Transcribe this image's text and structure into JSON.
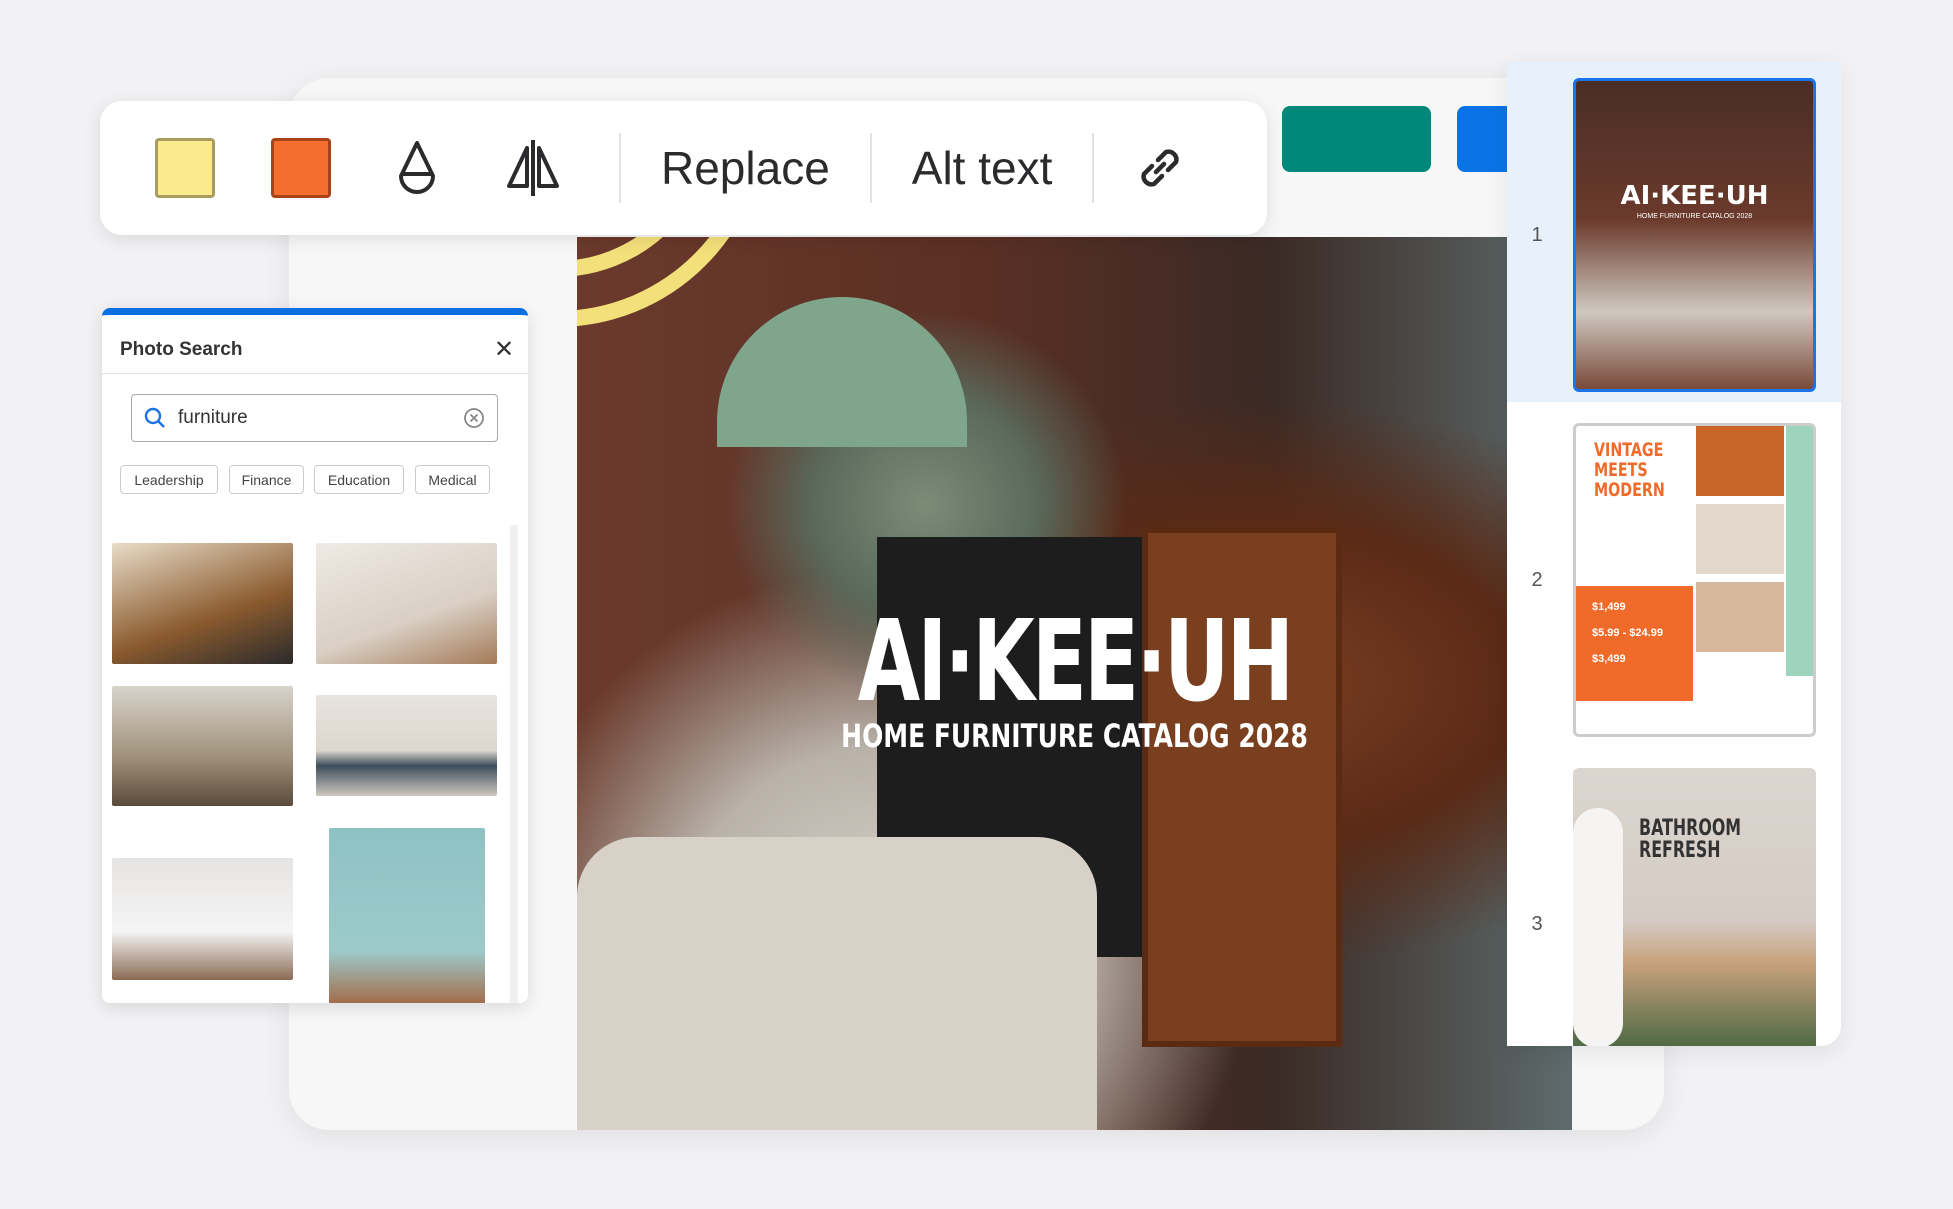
{
  "toolbar": {
    "swatches": [
      {
        "name": "yellow",
        "color": "#fde98e"
      },
      {
        "name": "orange",
        "color": "#f36f30"
      }
    ],
    "replace_label": "Replace",
    "alt_text_label": "Alt text",
    "accent_teal": "#00897a",
    "accent_blue": "#0a74e6"
  },
  "canvas": {
    "title": "AI·KEE·UH",
    "subtitle": "HOME FURNITURE CATALOG 2028"
  },
  "pages": [
    {
      "number": "1",
      "selected": true,
      "title": "AI·KEE·UH",
      "subtitle": "HOME FURNITURE CATALOG 2028"
    },
    {
      "number": "2",
      "title": "VINTAGE MEETS MODERN",
      "prices": [
        "$1,499",
        "$5.99 - $24.99",
        "$3,499"
      ]
    },
    {
      "number": "3",
      "title": "BATHROOM REFRESH"
    }
  ],
  "photo_search": {
    "title": "Photo Search",
    "query": "furniture",
    "chips": [
      "Leadership",
      "Finance",
      "Education",
      "Medical"
    ]
  }
}
